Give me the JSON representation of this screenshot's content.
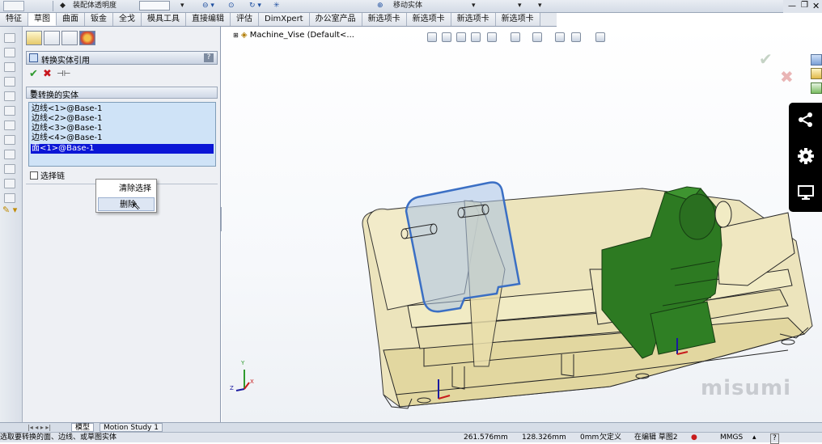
{
  "ribbon": {
    "transparency_label": "装配体透明度",
    "move_entity_label": "移动实体"
  },
  "tabs": [
    {
      "label": "特征"
    },
    {
      "label": "草图"
    },
    {
      "label": "曲面"
    },
    {
      "label": "钣金"
    },
    {
      "label": "全戈"
    },
    {
      "label": "模具工具"
    },
    {
      "label": "直接编辑"
    },
    {
      "label": "评估"
    },
    {
      "label": "DimXpert"
    },
    {
      "label": "办公室产品"
    },
    {
      "label": "新选项卡"
    },
    {
      "label": "新选项卡"
    },
    {
      "label": "新选项卡"
    },
    {
      "label": "新选项卡"
    }
  ],
  "active_tab_index": 1,
  "property_manager": {
    "title": "转换实体引用",
    "help_label": "?",
    "ok_symbol": "✔",
    "cancel_symbol": "✖",
    "group_title": "要转换的实体",
    "collapse_symbol": "≈",
    "entities": [
      {
        "label": "边线<1>@Base-1",
        "selected": false
      },
      {
        "label": "边线<2>@Base-1",
        "selected": false
      },
      {
        "label": "边线<3>@Base-1",
        "selected": false
      },
      {
        "label": "边线<4>@Base-1",
        "selected": false
      },
      {
        "label": "面<1>@Base-1",
        "selected": true
      }
    ],
    "select_chain_label": "选择链",
    "context_menu": [
      {
        "label": "清除选择",
        "hover": false
      },
      {
        "label": "删除",
        "hover": true
      }
    ]
  },
  "viewport": {
    "document_title": "Machine_Vise  (Default<...",
    "watermark": "misumi",
    "triad_labels": {
      "x": "X",
      "y": "Y",
      "z": "Z"
    }
  },
  "bottom_tabs": [
    {
      "label": "模型"
    },
    {
      "label": "Motion Study 1"
    }
  ],
  "status_bar": {
    "message": "选取要转换的面、边线、或草图实体",
    "x_coord": "261.576mm",
    "y_coord": "128.326mm",
    "z_coord": "0mm",
    "definition_state": "欠定义",
    "editing": "在编辑 草图2",
    "units": "MMGS",
    "help": "?"
  },
  "colors": {
    "selection_blue": "#0b16d6",
    "list_bg": "#cfe3f7",
    "ok_green": "#2f9a2f",
    "cancel_red": "#c8161d",
    "part_tan": "#e9dfa8",
    "part_green": "#2d7a22",
    "sketch_blue": "#3b6fc4"
  }
}
